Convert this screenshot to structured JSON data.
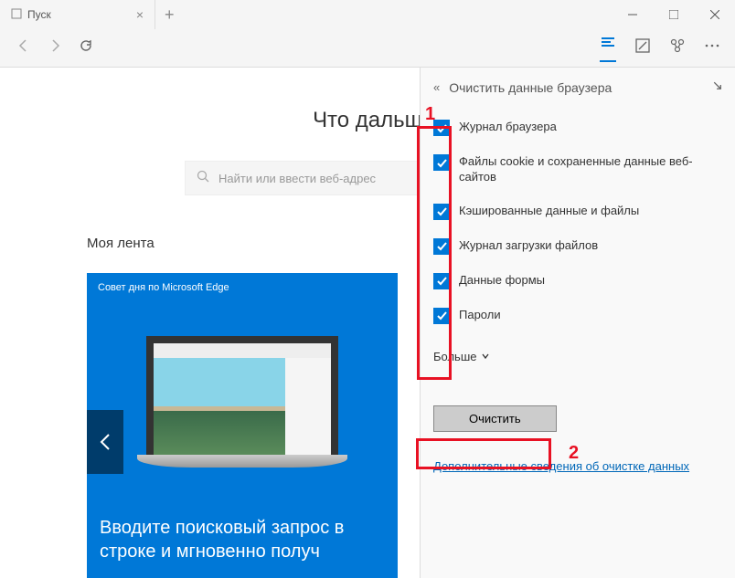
{
  "tab": {
    "title": "Пуск"
  },
  "main": {
    "heading": "Что дальш",
    "search_placeholder": "Найти или ввести веб-адрес",
    "feed_title": "Моя лента",
    "card_header": "Совет дня по Microsoft Edge",
    "card_text": "Вводите поисковый запрос в строке и мгновенно получ"
  },
  "panel": {
    "title": "Очистить данные браузера",
    "checkboxes": [
      "Журнал браузера",
      "Файлы cookie и сохраненные данные веб-сайтов",
      "Кэшированные данные и файлы",
      "Журнал загрузки файлов",
      "Данные формы",
      "Пароли"
    ],
    "more": "Больше",
    "clear_button": "Очистить",
    "more_link": "Дополнительные сведения об очистке данных"
  },
  "annotations": {
    "label1": "1",
    "label2": "2"
  }
}
